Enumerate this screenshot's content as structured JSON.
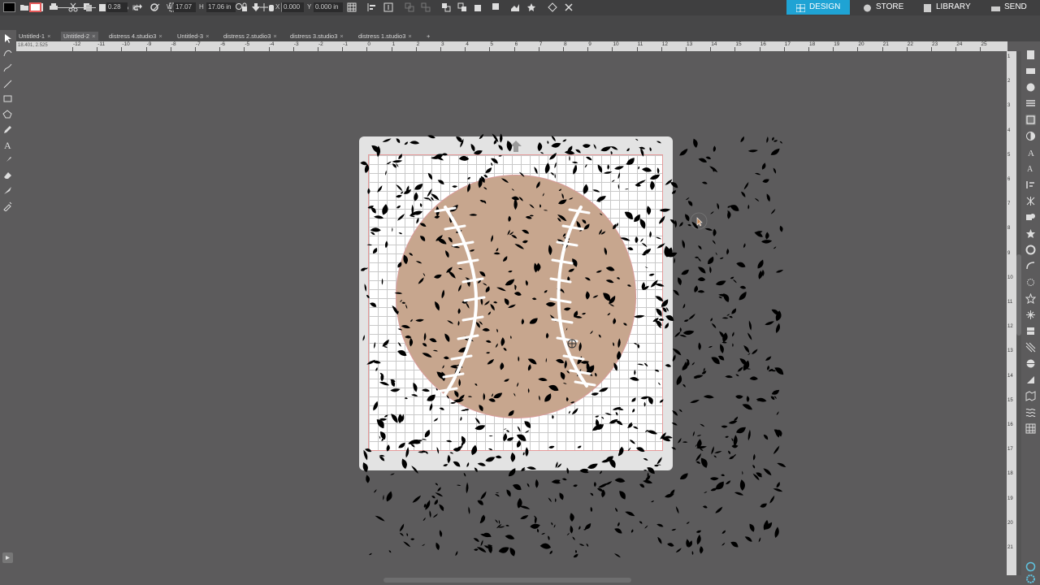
{
  "toolbar": {
    "line_width": "0.28",
    "line_width_unit": "pt",
    "width_label": "W",
    "width_value": "17.07",
    "height_label": "H",
    "height_value": "17.06 in",
    "x_label": "X",
    "x_value": "0.000",
    "y_label": "Y",
    "y_value": "0.000 in"
  },
  "nav": {
    "design": "DESIGN",
    "store": "STORE",
    "library": "LIBRARY",
    "send": "SEND"
  },
  "tabs": [
    {
      "label": "Untitled-1"
    },
    {
      "label": "Untitled-2"
    },
    {
      "label": "distress 4.studio3"
    },
    {
      "label": "Untitled-3"
    },
    {
      "label": "distress 2.studio3"
    },
    {
      "label": "distress 3.studio3"
    },
    {
      "label": "distress 1.studio3"
    }
  ],
  "coord_readout": "18.401, 2.525",
  "ruler_h_labels": [
    "-12",
    "-11",
    "-10",
    "-9",
    "-8",
    "-7",
    "-6",
    "-5",
    "-4",
    "-3",
    "-2",
    "-1",
    "0",
    "1",
    "2",
    "3",
    "4",
    "5",
    "6",
    "7",
    "8",
    "9",
    "10",
    "11",
    "12",
    "13",
    "14",
    "15",
    "16",
    "17",
    "18",
    "19",
    "20",
    "21",
    "22",
    "23",
    "24",
    "25"
  ],
  "ruler_v_labels": [
    "1",
    "2",
    "3",
    "4",
    "5",
    "6",
    "7",
    "8",
    "9",
    "10",
    "11",
    "12",
    "13",
    "14",
    "15",
    "16",
    "17",
    "18",
    "19",
    "20",
    "21"
  ],
  "colors": {
    "design_accent": "#1fa3d4",
    "mat": "#e3e3e3",
    "baseball": "#c7a68e",
    "cut_border": "#e59a9a",
    "workspace": "#5c5b5c"
  }
}
